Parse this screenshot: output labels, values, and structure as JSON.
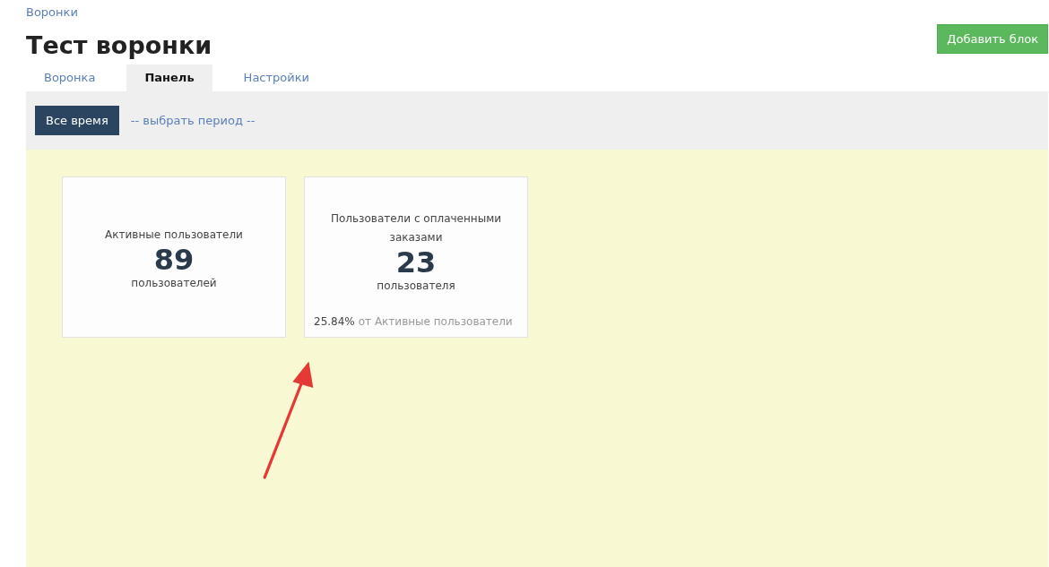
{
  "breadcrumb": "Воронки",
  "title": "Тест воронки",
  "add_button": "Добавить блок",
  "tabs": [
    {
      "label": "Воронка",
      "selected": false
    },
    {
      "label": "Панель",
      "selected": true
    },
    {
      "label": "Настройки",
      "selected": false
    }
  ],
  "period": {
    "button": "Все время",
    "link": "-- выбрать период --"
  },
  "cards": [
    {
      "title": "Активные пользователи",
      "value": "89",
      "unit": "пользователей"
    },
    {
      "title": "Пользователи с оплаченными заказами",
      "value": "23",
      "unit": "пользователя",
      "percent": "25.84%",
      "of_text": "от Активные пользователи"
    }
  ]
}
